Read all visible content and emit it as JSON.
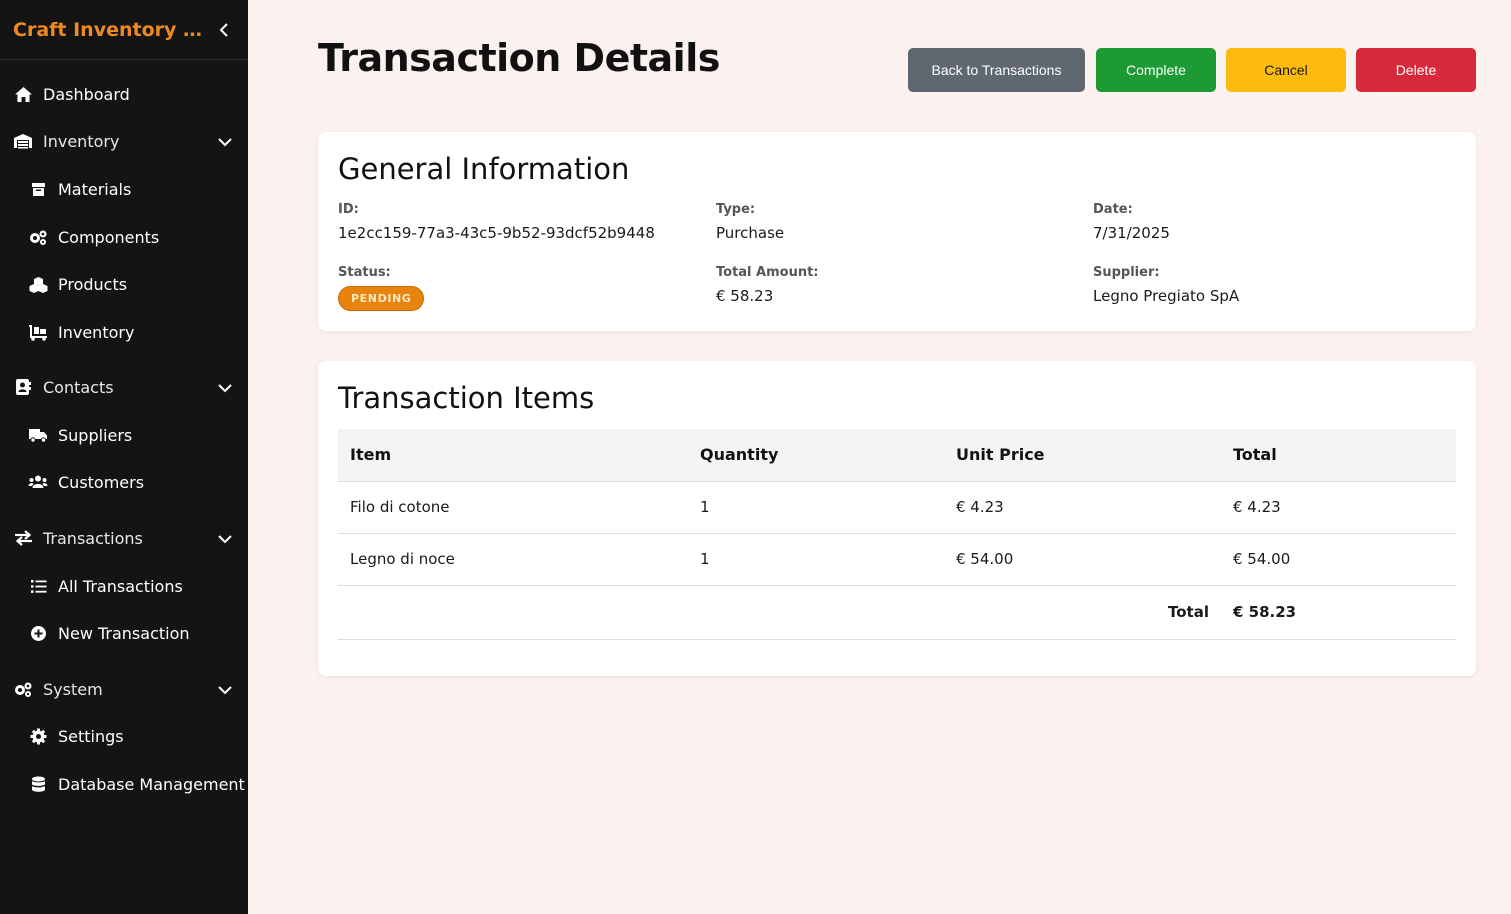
{
  "sidebar": {
    "app_title": "Craft Inventory Man...",
    "items": {
      "dashboard": "Dashboard",
      "inventory_group": "Inventory",
      "materials": "Materials",
      "components": "Components",
      "products": "Products",
      "inventory": "Inventory",
      "contacts_group": "Contacts",
      "suppliers": "Suppliers",
      "customers": "Customers",
      "transactions_group": "Transactions",
      "all_transactions": "All Transactions",
      "new_transaction": "New Transaction",
      "system_group": "System",
      "settings": "Settings",
      "database_management": "Database Management"
    },
    "accent_color": "#ee8a1e"
  },
  "header": {
    "title": "Transaction Details",
    "buttons": {
      "back": "Back to Transactions",
      "complete": "Complete",
      "cancel": "Cancel",
      "delete": "Delete"
    }
  },
  "general": {
    "heading": "General Information",
    "id_label": "ID:",
    "id_value": "1e2cc159-77a3-43c5-9b52-93dcf52b9448",
    "type_label": "Type:",
    "type_value": "Purchase",
    "date_label": "Date:",
    "date_value": "7/31/2025",
    "status_label": "Status:",
    "status_value": "PENDING",
    "total_label": "Total Amount:",
    "total_value": "€ 58.23",
    "supplier_label": "Supplier:",
    "supplier_value": "Legno Pregiato SpA"
  },
  "items": {
    "heading": "Transaction Items",
    "columns": [
      "Item",
      "Quantity",
      "Unit Price",
      "Total"
    ],
    "rows": [
      [
        "Filo di cotone",
        "1",
        "€ 4.23",
        "€ 4.23"
      ],
      [
        "Legno di noce",
        "1",
        "€ 54.00",
        "€ 54.00"
      ]
    ],
    "total_label": "Total",
    "total_value": "€ 58.23"
  }
}
